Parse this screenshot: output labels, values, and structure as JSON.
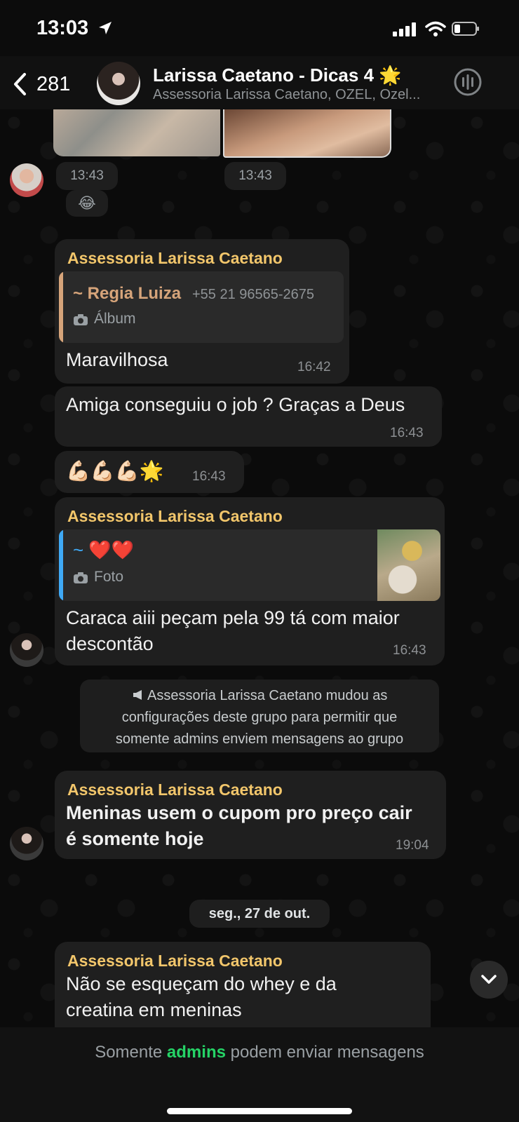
{
  "status_bar": {
    "time": "13:03"
  },
  "header": {
    "back_count": "281",
    "title": "Larissa Caetano - Dicas 4 🌟",
    "subtitle": "Assessoria Larissa Caetano, OZEL, Ozel..."
  },
  "top_timestamps": [
    "13:43",
    "13:43"
  ],
  "top_reaction": "😂",
  "messages": [
    {
      "sender": "Assessoria Larissa Caetano",
      "quote_name": "~ Regia Luiza",
      "quote_phone": "+55 21 96565-2675",
      "quote_label": "Álbum",
      "text": "Maravilhosa",
      "time": "16:42"
    },
    {
      "text": "Amiga conseguiu o job ? Graças a Deus",
      "time": "16:43"
    },
    {
      "text": "💪🏻💪🏻💪🏻🌟",
      "time": "16:43"
    },
    {
      "sender": "Assessoria Larissa Caetano",
      "quote_name": "~ ❤️❤️",
      "quote_label": "Foto",
      "text_line1": "Caraca aiii peçam pela 99 tá com maior",
      "text_line2": "descontão",
      "time": "16:43"
    },
    {
      "sender": "Assessoria Larissa Caetano",
      "text_line1": "Meninas usem o cupom pro preço cair",
      "text_line2": "é somente hoje",
      "time": "19:04"
    },
    {
      "sender": "Assessoria Larissa Caetano",
      "text_line1": "Não se esqueçam do whey e da",
      "text_line2": "creatina em meninas"
    }
  ],
  "system_notice": {
    "line1": "Assessoria Larissa Caetano mudou as",
    "line2": "configurações deste grupo para permitir que",
    "line3": "somente admins enviem mensagens ao grupo"
  },
  "date_divider": "seg., 27 de out.",
  "bottom": {
    "prefix": "Somente ",
    "admins": "admins",
    "suffix": " podem enviar mensagens"
  },
  "colors": {
    "sender": "#f2c66b",
    "quote_bar_1": "#d6a47a",
    "quote_bar_2": "#3fa9f5",
    "admins_accent": "#25d366"
  }
}
